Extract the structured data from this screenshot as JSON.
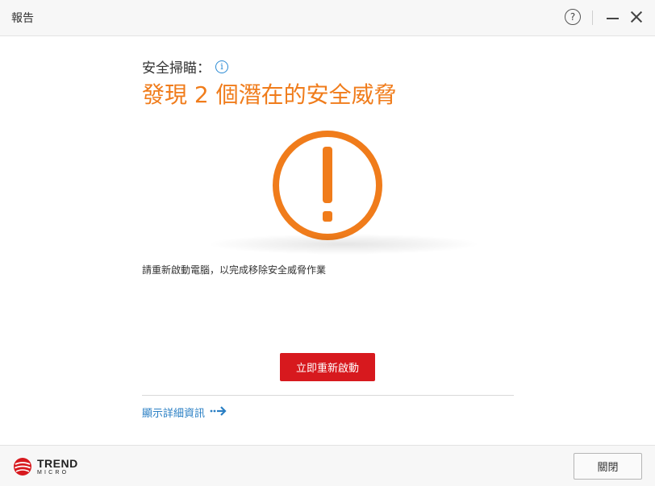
{
  "window": {
    "title": "報告",
    "help_glyph": "?"
  },
  "scan": {
    "label": "安全掃瞄：",
    "info_glyph": "i",
    "headline": "發現 2 個潛在的安全威脅"
  },
  "message": "請重新啟動電腦，以完成移除安全威脅作業",
  "actions": {
    "restart_label": "立即重新啟動",
    "details_label": "顯示詳細資訊"
  },
  "footer": {
    "logo_line1": "TREND",
    "logo_line2": "MICRO",
    "close_label": "關閉"
  },
  "colors": {
    "warning_orange": "#f07c1b",
    "restart_red": "#d7191e",
    "link_blue": "#2a7fc4"
  },
  "icons": [
    "help-icon",
    "minimize-icon",
    "close-icon",
    "info-icon",
    "warning-icon",
    "arrow-right-icon",
    "trend-micro-logo"
  ]
}
